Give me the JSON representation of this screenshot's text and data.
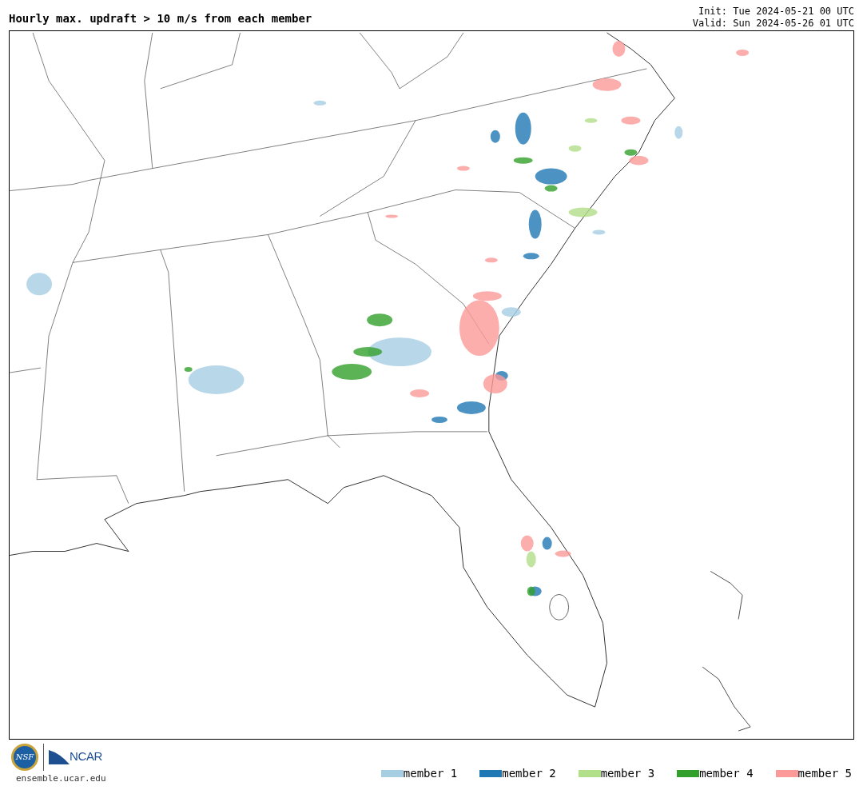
{
  "title": "Hourly max. updraft > 10 m/s from each member",
  "init": "Init: Tue 2024-05-21 00 UTC",
  "valid": "Valid: Sun 2024-05-26 01 UTC",
  "logos": {
    "nsf": "NSF",
    "ncar": "NCAR"
  },
  "site": "ensemble.ucar.edu",
  "legend": [
    {
      "label": "member 1",
      "color": "#a6cee3"
    },
    {
      "label": "member 2",
      "color": "#1f78b4"
    },
    {
      "label": "member 3",
      "color": "#b2df8a"
    },
    {
      "label": "member 4",
      "color": "#33a02c"
    },
    {
      "label": "member 5",
      "color": "#fb9a99"
    }
  ]
}
